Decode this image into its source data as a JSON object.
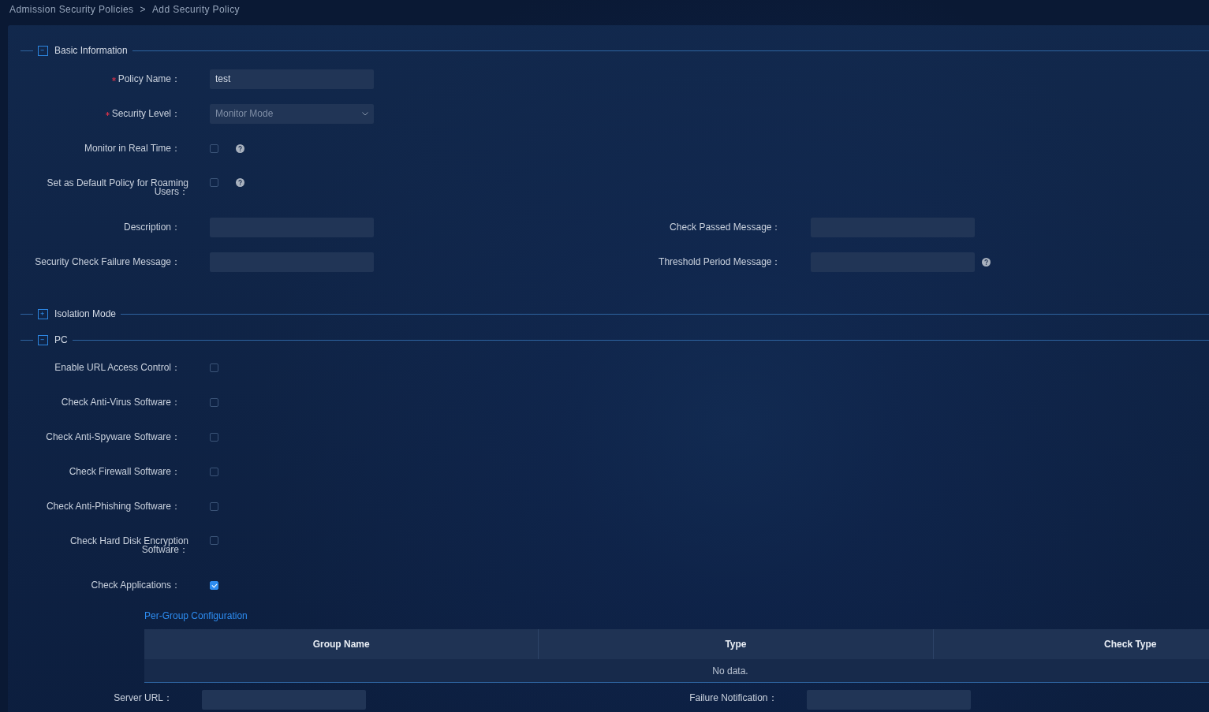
{
  "breadcrumb": [
    {
      "label": "Admission Security Policies"
    },
    {
      "label": "Add Security Policy"
    }
  ],
  "breadcrumb_separator": ">",
  "sections": [
    {
      "title": "Basic Information",
      "expanded": true,
      "rows": [
        [
          {
            "label": "Policy Name：",
            "required": true,
            "kind": "input",
            "value": "test"
          }
        ],
        [
          {
            "label": "Security Level：",
            "required": true,
            "kind": "select",
            "value": "Monitor Mode"
          }
        ],
        [
          {
            "label": "Monitor in Real Time：",
            "kind": "checkbox",
            "checked": false,
            "help": true
          }
        ],
        [
          {
            "label": "Set as Default Policy for Roaming Users：",
            "kind": "checkbox",
            "checked": false,
            "help": true
          }
        ],
        [
          {
            "label": "Description：",
            "kind": "input"
          },
          {
            "label": "Check Passed Message：",
            "kind": "input"
          }
        ],
        [
          {
            "label": "Security Check Failure Message：",
            "kind": "input"
          },
          {
            "label": "Threshold Period Message：",
            "kind": "input",
            "help": true
          }
        ]
      ]
    },
    {
      "title": "Isolation Mode",
      "expanded": false
    },
    {
      "title": "PC",
      "expanded": true,
      "rows": [
        [
          {
            "label": "Enable URL Access Control：",
            "kind": "checkbox",
            "checked": false
          }
        ],
        [
          {
            "label": "Check Anti-Virus Software：",
            "kind": "checkbox",
            "checked": false
          }
        ],
        [
          {
            "label": "Check Anti-Spyware Software：",
            "kind": "checkbox",
            "checked": false
          }
        ],
        [
          {
            "label": "Check Firewall Software：",
            "kind": "checkbox",
            "checked": false
          }
        ],
        [
          {
            "label": "Check Anti-Phishing Software：",
            "kind": "checkbox",
            "checked": false
          }
        ],
        [
          {
            "label": "Check Hard Disk Encryption Software：",
            "kind": "checkbox",
            "checked": false
          }
        ],
        [
          {
            "label": "Check Applications：",
            "kind": "checkbox",
            "checked": true
          }
        ]
      ]
    }
  ],
  "group_config": {
    "link": "Per-Group Configuration",
    "table": {
      "columns": [
        "Group Name",
        "Type",
        "Check Type"
      ],
      "empty_text": "No data."
    }
  },
  "bottom_row": [
    {
      "label": "Server URL：",
      "kind": "input"
    },
    {
      "label": "Failure Notification：",
      "kind": "input"
    }
  ]
}
